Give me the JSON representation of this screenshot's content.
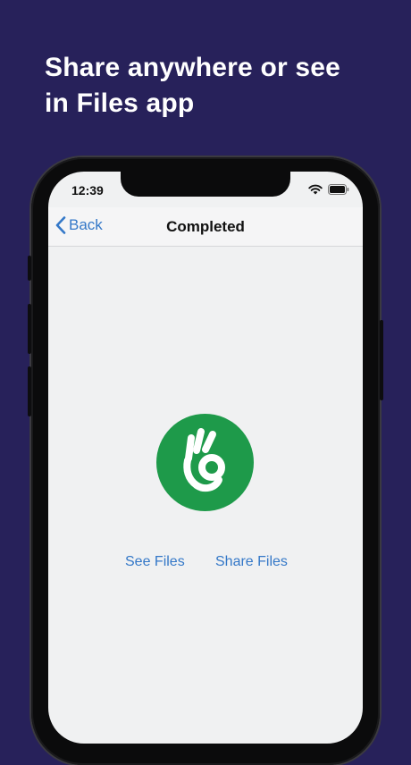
{
  "headline": {
    "line1": "Share anywhere or see",
    "line2": "in Files app"
  },
  "status_bar": {
    "time": "12:39",
    "icons": [
      "wifi-icon",
      "battery-icon"
    ]
  },
  "nav": {
    "back_label": "Back",
    "title": "Completed"
  },
  "badge": {
    "icon": "ok-hand-icon",
    "color": "#1e9a4a"
  },
  "actions": {
    "see_files": "See Files",
    "share_files": "Share Files"
  },
  "colors": {
    "background": "#27215a",
    "accent": "#3478c8"
  }
}
